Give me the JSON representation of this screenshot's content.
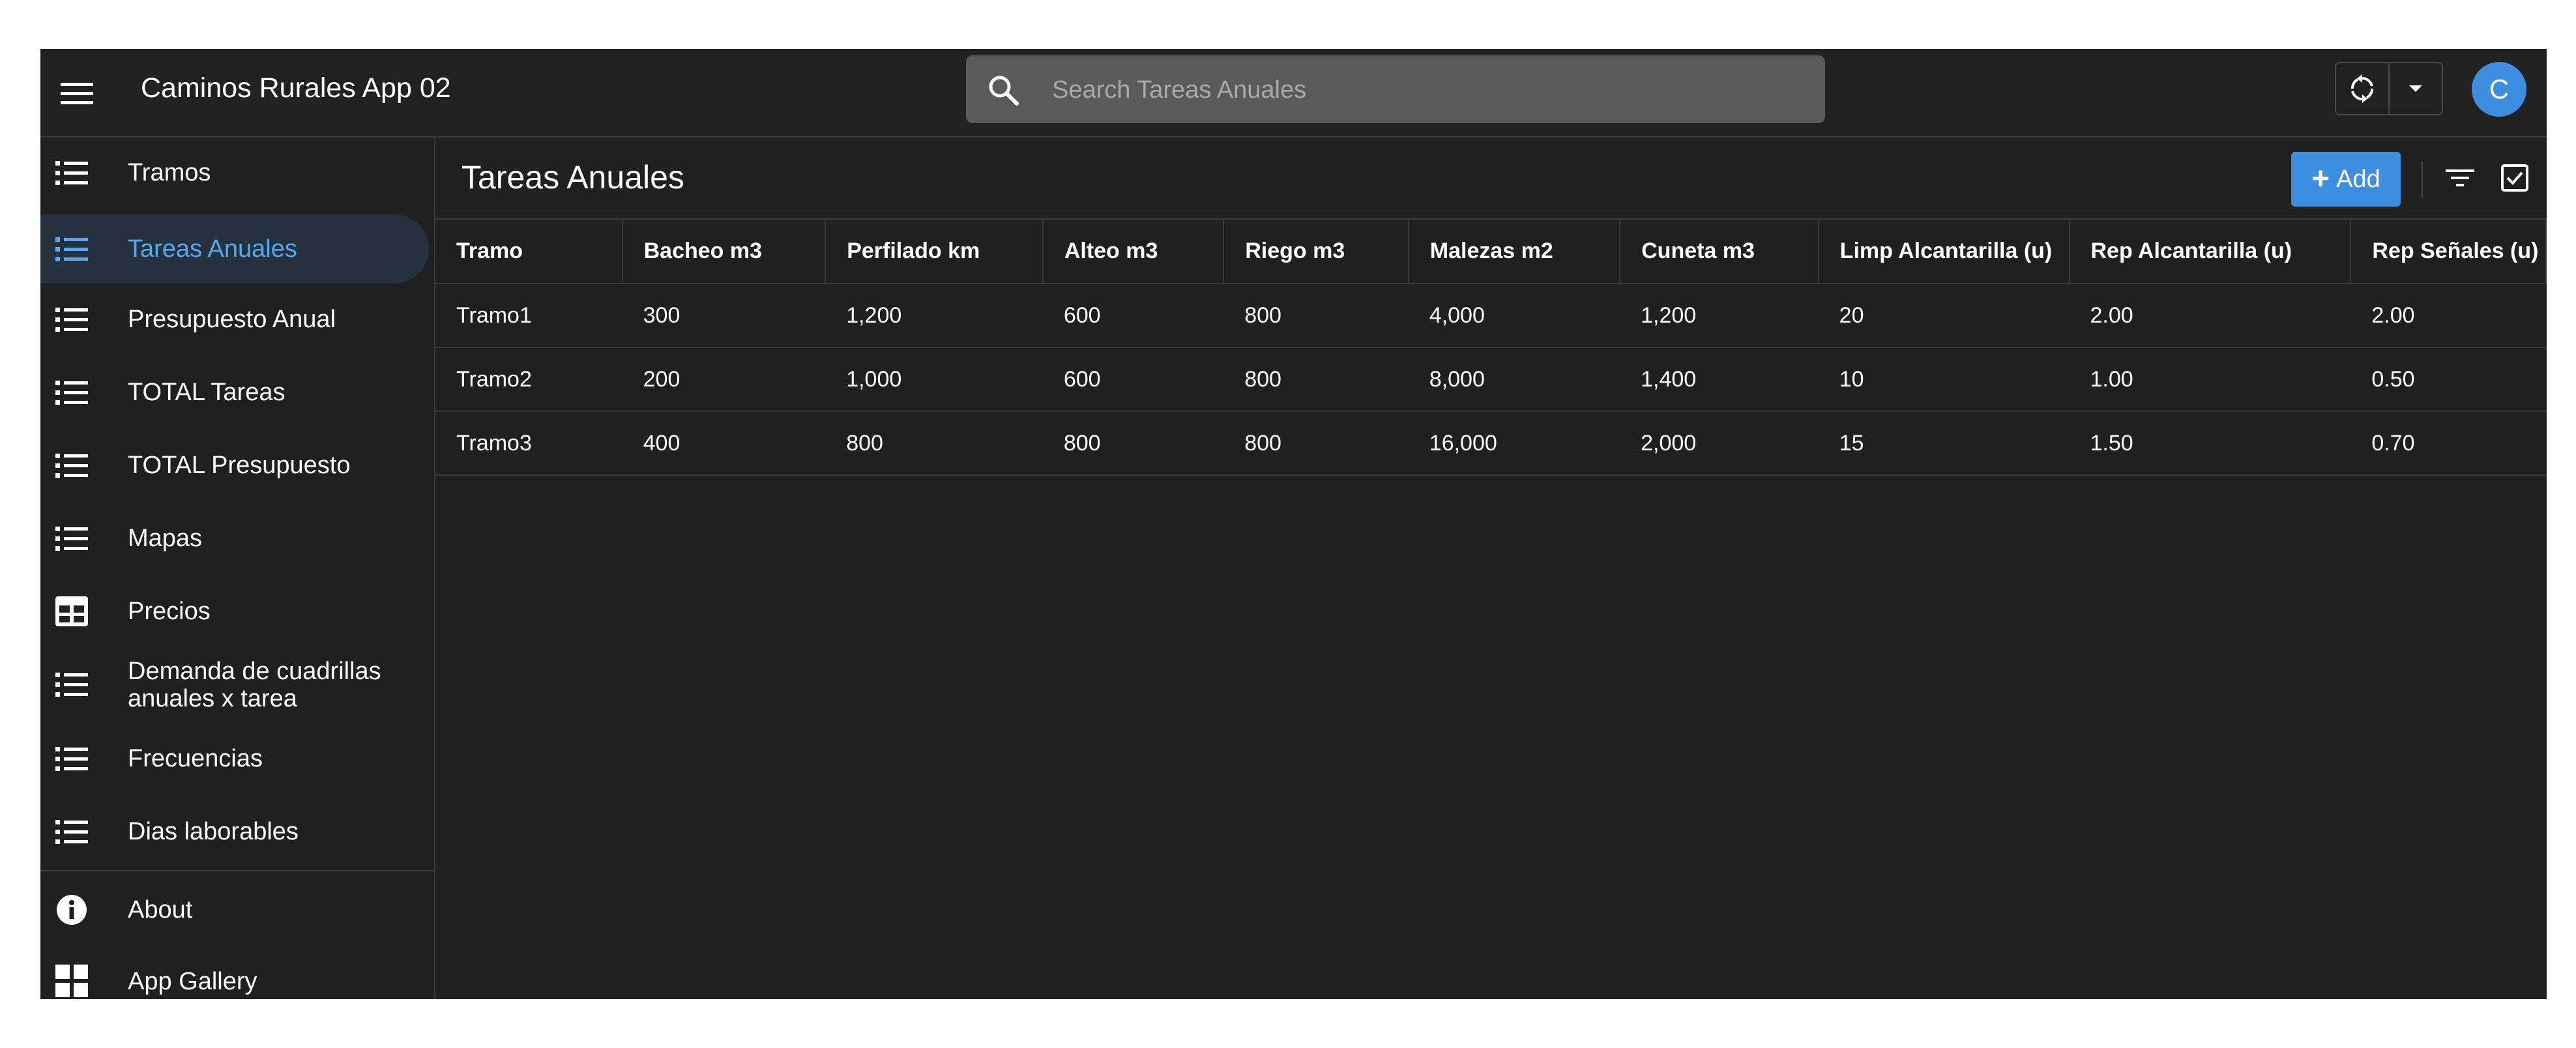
{
  "app": {
    "title": "Caminos Rurales App 02",
    "accent_color": "#3d8ee0",
    "background_color": "#202020"
  },
  "search": {
    "placeholder": "Search Tareas Anuales",
    "value": ""
  },
  "user": {
    "avatar_initial": "C"
  },
  "sidebar": {
    "items": [
      {
        "label": "Tramos",
        "icon": "list-icon",
        "active": false
      },
      {
        "label": "Tareas Anuales",
        "icon": "list-icon",
        "active": true
      },
      {
        "label": "Presupuesto Anual",
        "icon": "list-icon",
        "active": false
      },
      {
        "label": "TOTAL Tareas",
        "icon": "list-icon",
        "active": false
      },
      {
        "label": "TOTAL Presupuesto",
        "icon": "list-icon",
        "active": false
      },
      {
        "label": "Mapas",
        "icon": "list-icon",
        "active": false
      },
      {
        "label": "Precios",
        "icon": "table-icon",
        "active": false
      },
      {
        "label_line1": "Demanda de cuadrillas",
        "label_line2": "anuales x tarea",
        "icon": "list-icon",
        "active": false
      },
      {
        "label": "Frecuencias",
        "icon": "list-icon",
        "active": false
      },
      {
        "label": "Dias laborables",
        "icon": "list-icon",
        "active": false
      }
    ],
    "footer": [
      {
        "label": "About",
        "icon": "info-icon"
      },
      {
        "label": "App Gallery",
        "icon": "grid-icon"
      }
    ]
  },
  "main": {
    "title": "Tareas Anuales",
    "add_label": "Add",
    "table": {
      "columns": [
        "Tramo",
        "Bacheo m3",
        "Perfilado km",
        "Alteo m3",
        "Riego m3",
        "Malezas m2",
        "Cuneta m3",
        "Limp Alcantarilla (u)",
        "Rep Alcantarilla (u)",
        "Rep Señales (u)"
      ],
      "rows": [
        [
          "Tramo1",
          "300",
          "1,200",
          "600",
          "800",
          "4,000",
          "1,200",
          "20",
          "2.00",
          "2.00"
        ],
        [
          "Tramo2",
          "200",
          "1,000",
          "600",
          "800",
          "8,000",
          "1,400",
          "10",
          "1.00",
          "0.50"
        ],
        [
          "Tramo3",
          "400",
          "800",
          "800",
          "800",
          "16,000",
          "2,000",
          "15",
          "1.50",
          "0.70"
        ]
      ]
    }
  }
}
